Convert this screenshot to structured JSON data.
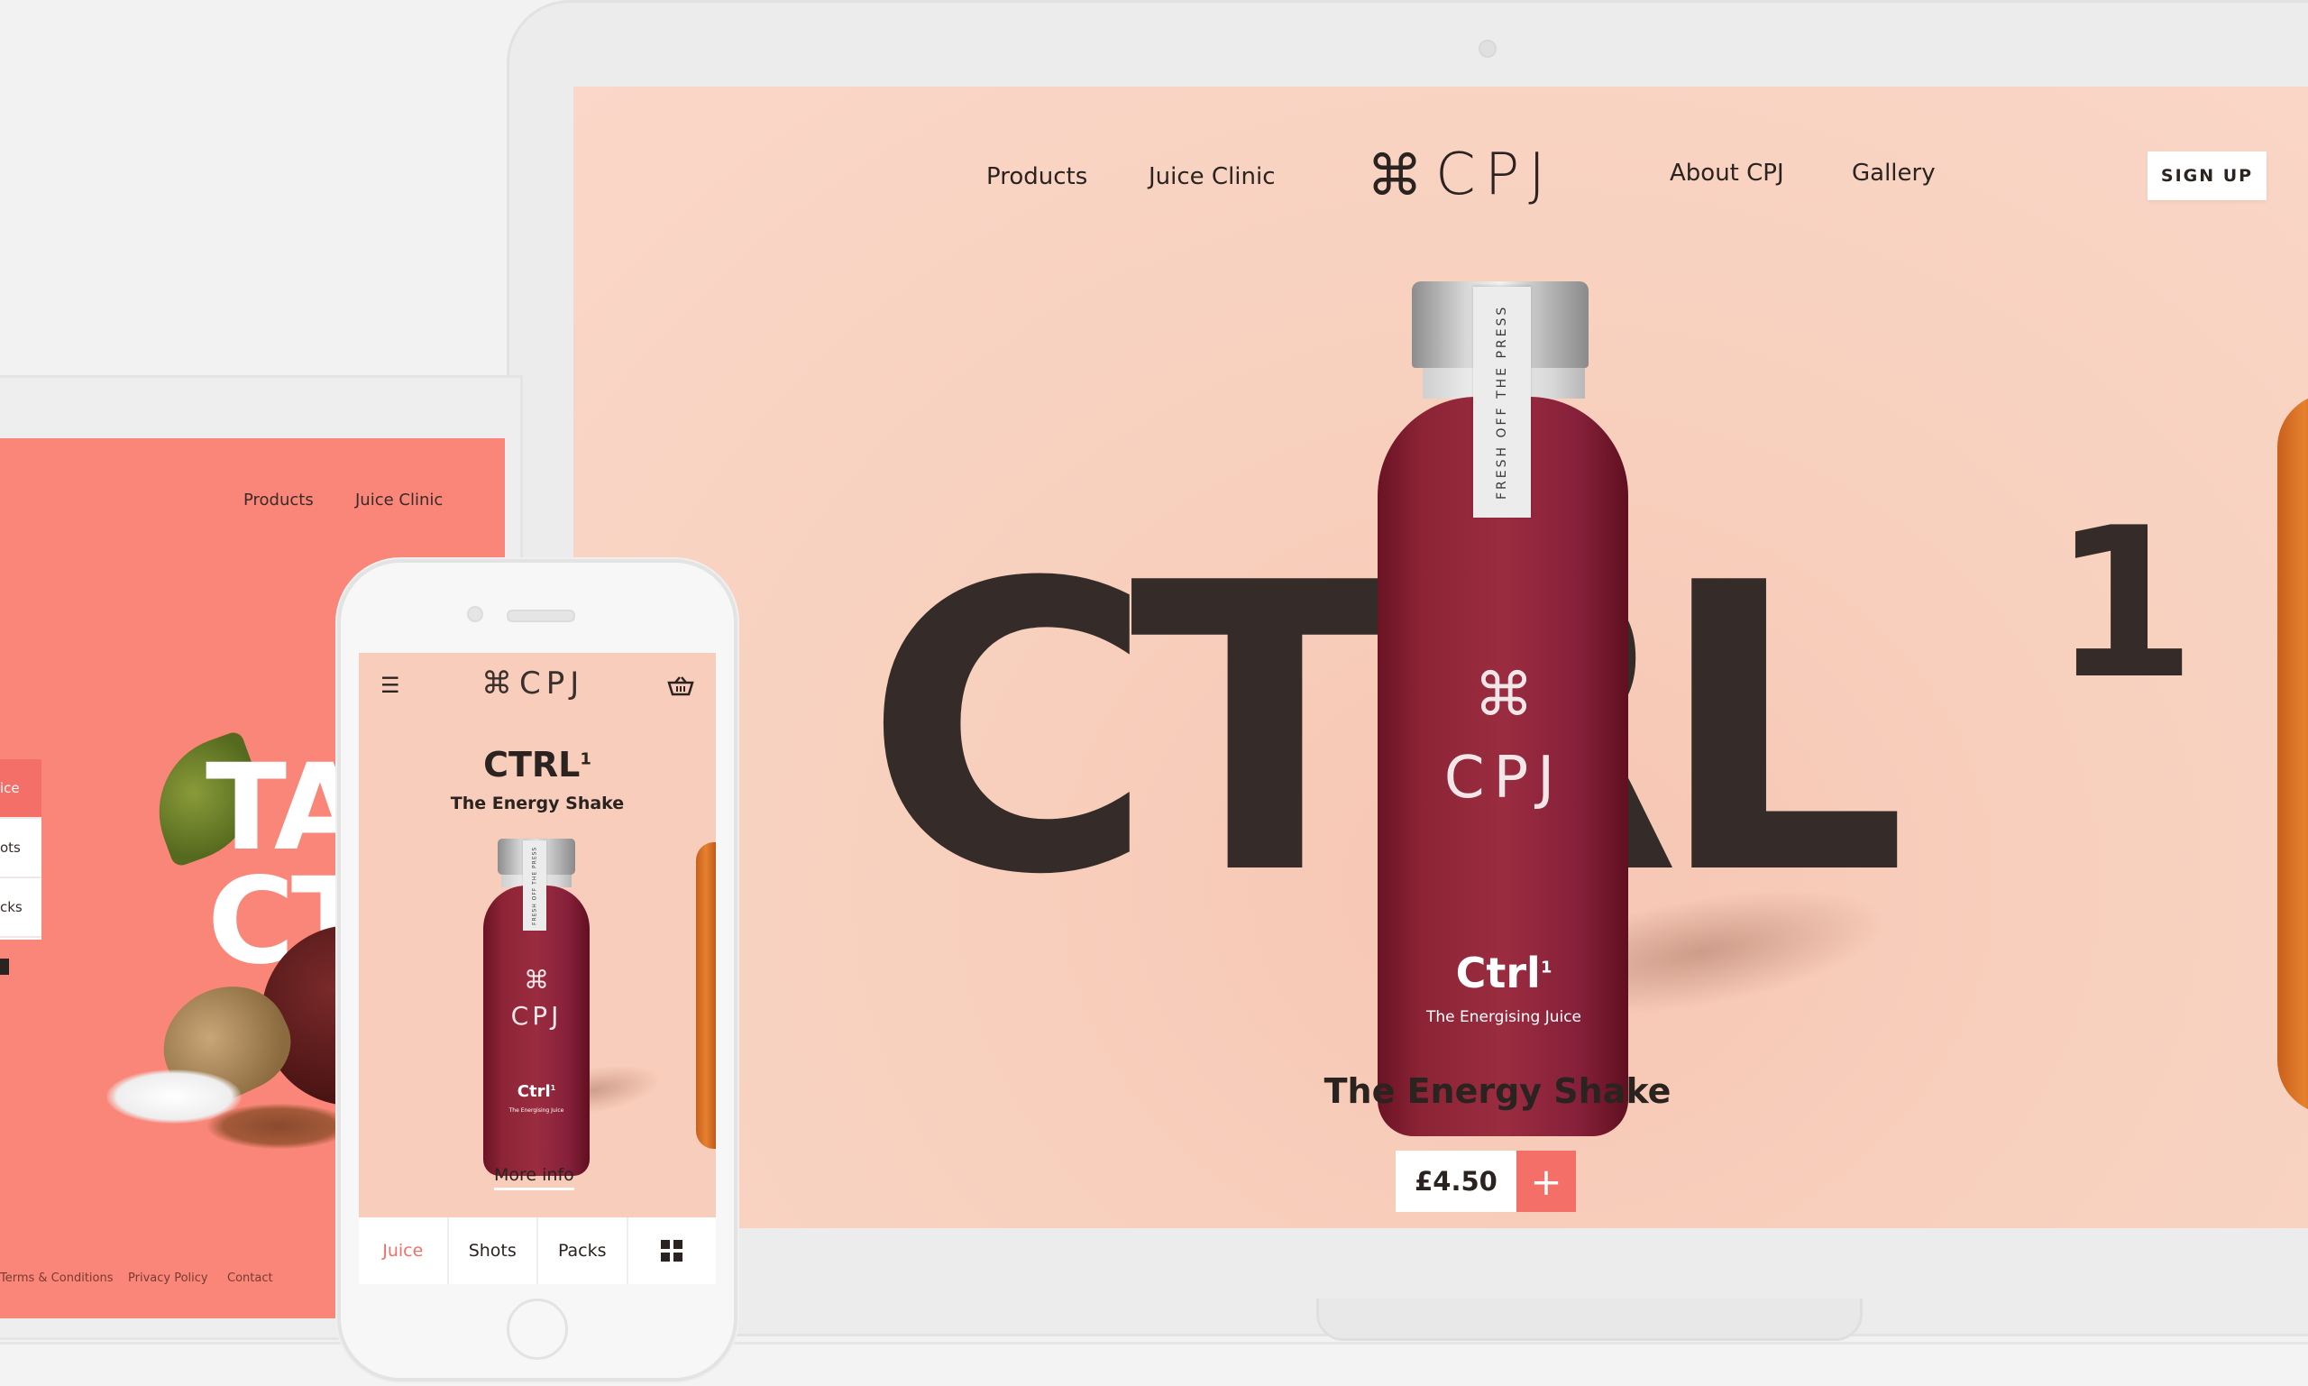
{
  "desktop": {
    "nav_left": [
      "Products",
      "Juice Clinic"
    ],
    "logo_symbol": "⌘",
    "logo_text": "CPJ",
    "nav_right": [
      "About CPJ",
      "Gallery"
    ],
    "signup_label": "SIGN UP",
    "hero_word": "CTRL",
    "hero_superscript": "1",
    "bottle": {
      "strip_text": "FRESH OFF THE PRESS",
      "logo_symbol": "⌘",
      "logo_text": "CPJ",
      "name": "Ctrl",
      "name_sup": "1",
      "tagline": "The Energising Juice"
    },
    "product_title": "The Energy Shake",
    "price": "£4.50",
    "add_icon": "+"
  },
  "tablet": {
    "nav": [
      "Products",
      "Juice Clinic"
    ],
    "hero_line1": "TA",
    "hero_line2": "CT",
    "menu": [
      "ice",
      "ots",
      "cks"
    ],
    "footer": [
      "Terms & Conditions",
      "Privacy Policy",
      "Contact"
    ]
  },
  "phone": {
    "menu_icon": "☰",
    "logo_symbol": "⌘",
    "logo_text": "CPJ",
    "basket_icon": "basket-icon",
    "title": "CTRL",
    "title_sup": "1",
    "subtitle": "The Energy Shake",
    "bottle": {
      "strip_text": "FRESH OFF THE PRESS",
      "logo_symbol": "⌘",
      "logo_text": "CPJ",
      "name": "Ctrl",
      "name_sup": "1",
      "tagline": "The Energising Juice"
    },
    "more_info": "More info",
    "tabs": [
      "Juice",
      "Shots",
      "Packs"
    ],
    "active_tab": "Juice"
  },
  "colors": {
    "desktop_bg": "#fad7c8",
    "tablet_bg": "#f98679",
    "accent": "#f36f68",
    "dark_text": "#352b28",
    "juice_red": "#8c2436"
  }
}
